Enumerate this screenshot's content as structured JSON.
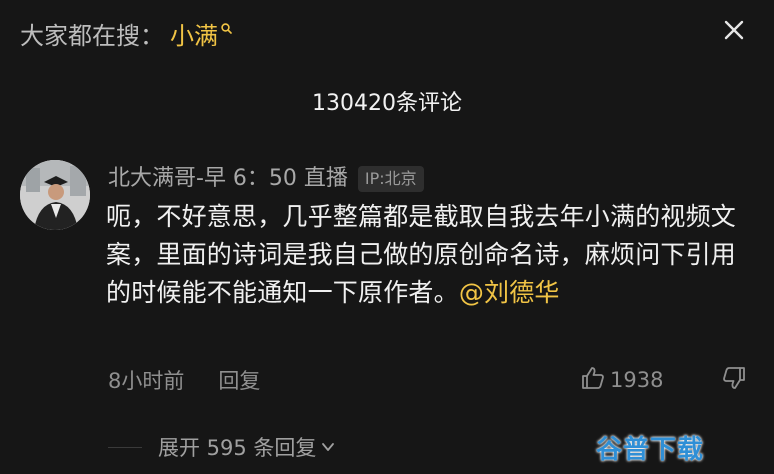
{
  "search": {
    "prefix": "大家都在搜：",
    "keyword": "小满"
  },
  "header": {
    "comment_count_label": "130420条评论"
  },
  "comment": {
    "username": "北大满哥-早 6：50 直播",
    "ip_location": "IP:北京",
    "body_text": "呃，不好意思，几乎整篇都是截取自我去年小满的视频文案，里面的诗词是我自己做的原创命名诗，麻烦问下引用的时候能不能通知一下原作者。",
    "mention": "@刘德华",
    "time_ago": "8小时前",
    "reply_label": "回复",
    "like_count": "1938"
  },
  "replies": {
    "expand_label": "展开 595 条回复"
  },
  "watermark": {
    "text": "谷普下载"
  },
  "colors": {
    "background": "#161616",
    "accent": "#f1c445",
    "secondary_text": "#8f8f8f",
    "watermark": "#2f8fd6"
  },
  "icons": {
    "search": "search-icon",
    "close": "close-icon",
    "like": "thumbs-up-icon",
    "dislike": "thumbs-down-icon",
    "expand": "chevron-down-icon"
  }
}
